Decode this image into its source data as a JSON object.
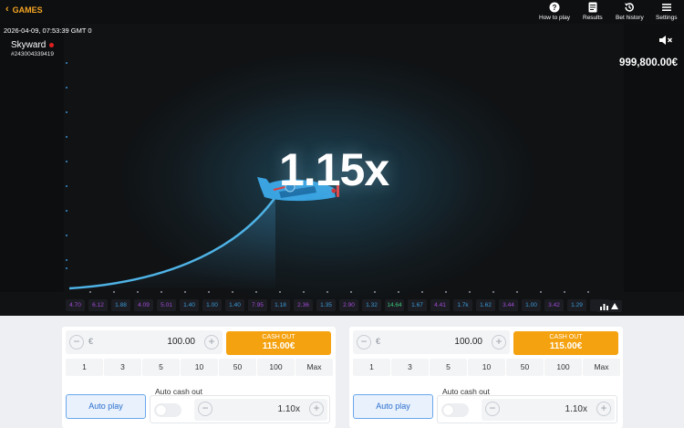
{
  "nav": {
    "back_label": "GAMES",
    "how_to_play": "How to play",
    "results": "Results",
    "bet_history": "Bet history",
    "settings": "Settings"
  },
  "game": {
    "timestamp": "2026-04-09, 07:53:39 GMT 0",
    "name": "Skyward",
    "round_id": "#243004339419",
    "balance": "999,800.00€",
    "multiplier": "1.15x"
  },
  "history": [
    {
      "value": "4.70",
      "color": "purple"
    },
    {
      "value": "6.12",
      "color": "purple"
    },
    {
      "value": "1.88",
      "color": "blue"
    },
    {
      "value": "4.09",
      "color": "purple"
    },
    {
      "value": "5.01",
      "color": "purple"
    },
    {
      "value": "1.40",
      "color": "blue"
    },
    {
      "value": "1.00",
      "color": "blue"
    },
    {
      "value": "1.40",
      "color": "blue"
    },
    {
      "value": "7.95",
      "color": "purple"
    },
    {
      "value": "1.18",
      "color": "blue"
    },
    {
      "value": "2.36",
      "color": "purple"
    },
    {
      "value": "1.35",
      "color": "blue"
    },
    {
      "value": "2.90",
      "color": "purple"
    },
    {
      "value": "1.32",
      "color": "blue"
    },
    {
      "value": "14.64",
      "color": "green"
    },
    {
      "value": "1.67",
      "color": "blue"
    },
    {
      "value": "4.41",
      "color": "purple"
    },
    {
      "value": "1.7k",
      "color": "blue"
    },
    {
      "value": "1.62",
      "color": "blue"
    },
    {
      "value": "3.44",
      "color": "purple"
    },
    {
      "value": "1.00",
      "color": "blue"
    },
    {
      "value": "3.42",
      "color": "purple"
    },
    {
      "value": "1.29",
      "color": "blue"
    },
    {
      "value": "1",
      "color": "pink"
    }
  ],
  "panels": [
    {
      "currency": "€",
      "stake": "100.00",
      "minus": "−",
      "plus": "+",
      "cashout_label": "CASH OUT",
      "cashout_amount": "115.00€",
      "chips": [
        "1",
        "3",
        "5",
        "10",
        "50",
        "100",
        "Max"
      ],
      "autoplay_label": "Auto play",
      "autocash_label": "Auto cash out",
      "autocash_value": "1.10x",
      "autocash_enabled": false
    },
    {
      "currency": "€",
      "stake": "100.00",
      "minus": "−",
      "plus": "+",
      "cashout_label": "CASH OUT",
      "cashout_amount": "115.00€",
      "chips": [
        "1",
        "3",
        "5",
        "10",
        "50",
        "100",
        "Max"
      ],
      "autoplay_label": "Auto play",
      "autocash_label": "Auto cash out",
      "autocash_value": "1.10x",
      "autocash_enabled": false
    }
  ],
  "colors": {
    "accent": "#f5a623",
    "cashout": "#f5a210",
    "curve": "#4fb3e6",
    "autoplay_border": "#6aa7ec",
    "live_dot": "#e02020"
  },
  "icons": {
    "back": "chevron-left-icon",
    "how_to_play": "question-circle-icon",
    "results": "document-list-icon",
    "bet_history": "history-clock-icon",
    "settings": "hamburger-menu-icon",
    "sound": "speaker-muted-icon",
    "stats": "bar-chart-icon",
    "expand": "triangle-up-icon"
  }
}
